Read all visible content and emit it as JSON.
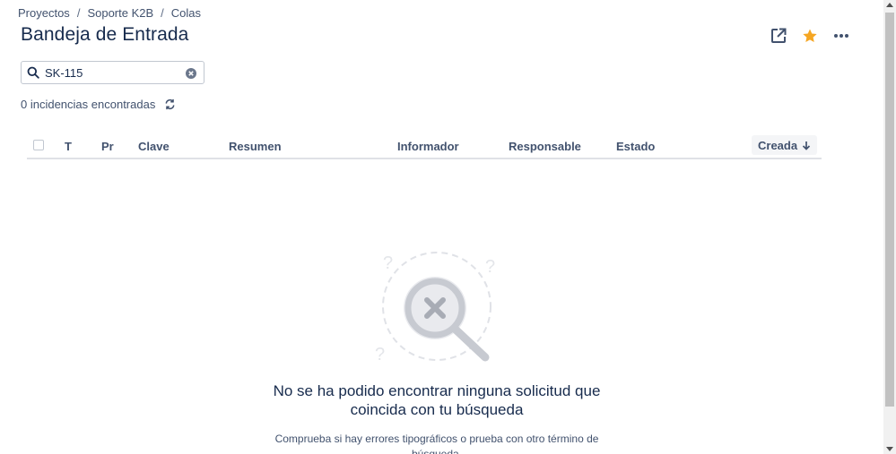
{
  "breadcrumb": {
    "items": [
      "Proyectos",
      "Soporte K2B",
      "Colas"
    ],
    "separator": "/"
  },
  "page": {
    "title": "Bandeja de Entrada"
  },
  "header_actions": {
    "icons": [
      "external-link-icon",
      "star-icon",
      "more-icon"
    ],
    "star_color": "#f5a623"
  },
  "search": {
    "value": "SK-115",
    "placeholder": "Buscar"
  },
  "results": {
    "count_text": "0 incidencias encontradas"
  },
  "table": {
    "columns": [
      "T",
      "Pr",
      "Clave",
      "Resumen",
      "Informador",
      "Responsable",
      "Estado"
    ],
    "sort_column": "Creada"
  },
  "empty_state": {
    "title": "No se ha podido encontrar ninguna solicitud que coincida con tu búsqueda",
    "description": "Comprueba si hay errores tipográficos o prueba con otro término de búsqueda."
  }
}
